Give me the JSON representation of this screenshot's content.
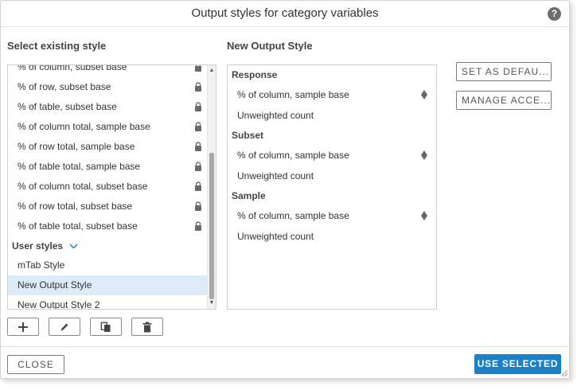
{
  "dialog": {
    "title": "Output styles for category variables",
    "help_icon_glyph": "?",
    "accent_color": "#1b80c5"
  },
  "left_panel": {
    "label": "Select existing style",
    "items": [
      {
        "label": "% of column, subset base",
        "locked": true
      },
      {
        "label": "% of row, subset base",
        "locked": true
      },
      {
        "label": "% of table, subset base",
        "locked": true
      },
      {
        "label": "% of column total, sample base",
        "locked": true
      },
      {
        "label": "% of row total, sample base",
        "locked": true
      },
      {
        "label": "% of table total, sample base",
        "locked": true
      },
      {
        "label": "% of column total, subset base",
        "locked": true
      },
      {
        "label": "% of row total, subset base",
        "locked": true
      },
      {
        "label": "% of table total, subset base",
        "locked": true
      }
    ],
    "user_group": {
      "label": "User styles",
      "items": [
        {
          "label": "mTab Style",
          "selected": false
        },
        {
          "label": "New Output Style",
          "selected": true
        },
        {
          "label": "New Output Style 2",
          "selected": false
        }
      ]
    },
    "toolbar_icons": [
      "plus-icon",
      "pencil-icon",
      "copy-icon",
      "trash-icon"
    ]
  },
  "right_panel": {
    "label": "New Output Style",
    "groups": [
      {
        "title": "Response",
        "items": [
          {
            "label": "% of column, sample base",
            "has_diamond": true
          },
          {
            "label": "Unweighted count",
            "has_diamond": false
          }
        ]
      },
      {
        "title": "Subset",
        "items": [
          {
            "label": "% of column, sample base",
            "has_diamond": true
          },
          {
            "label": "Unweighted count",
            "has_diamond": false
          }
        ]
      },
      {
        "title": "Sample",
        "items": [
          {
            "label": "% of column, sample base",
            "has_diamond": true
          },
          {
            "label": "Unweighted count",
            "has_diamond": false
          }
        ]
      }
    ]
  },
  "buttons": {
    "set_default": "SET AS DEFAU...",
    "manage_access": "MANAGE ACCE...",
    "close": "CLOSE",
    "use_selected": "USE SELECTED"
  }
}
